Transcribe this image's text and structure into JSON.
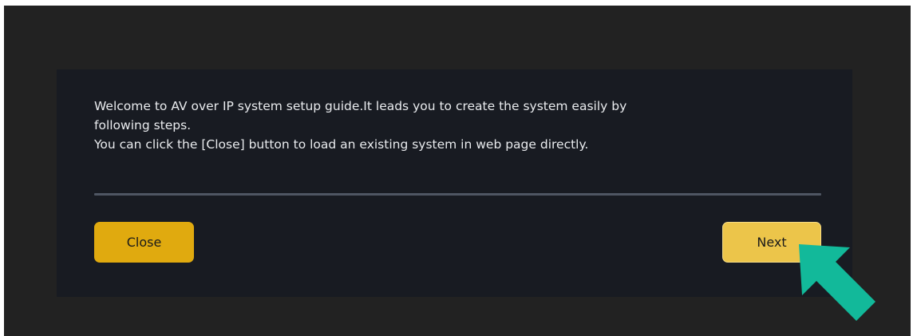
{
  "dialog": {
    "message_lines": [
      "Welcome to AV over IP system setup guide.It leads you to create the system easily by",
      "following steps.",
      "You can click the [Close] button to load an existing system in web page directly."
    ],
    "close_label": "Close",
    "next_label": "Next"
  },
  "annotation": {
    "icon": "arrow-up-left-icon",
    "color": "#12b99a"
  },
  "colors": {
    "backdrop": "#222222",
    "dialog": "#181b22",
    "close_button": "#e0aa0f",
    "next_button": "#ecc54a",
    "divider": "#4f5663",
    "text": "#e9ebee"
  }
}
